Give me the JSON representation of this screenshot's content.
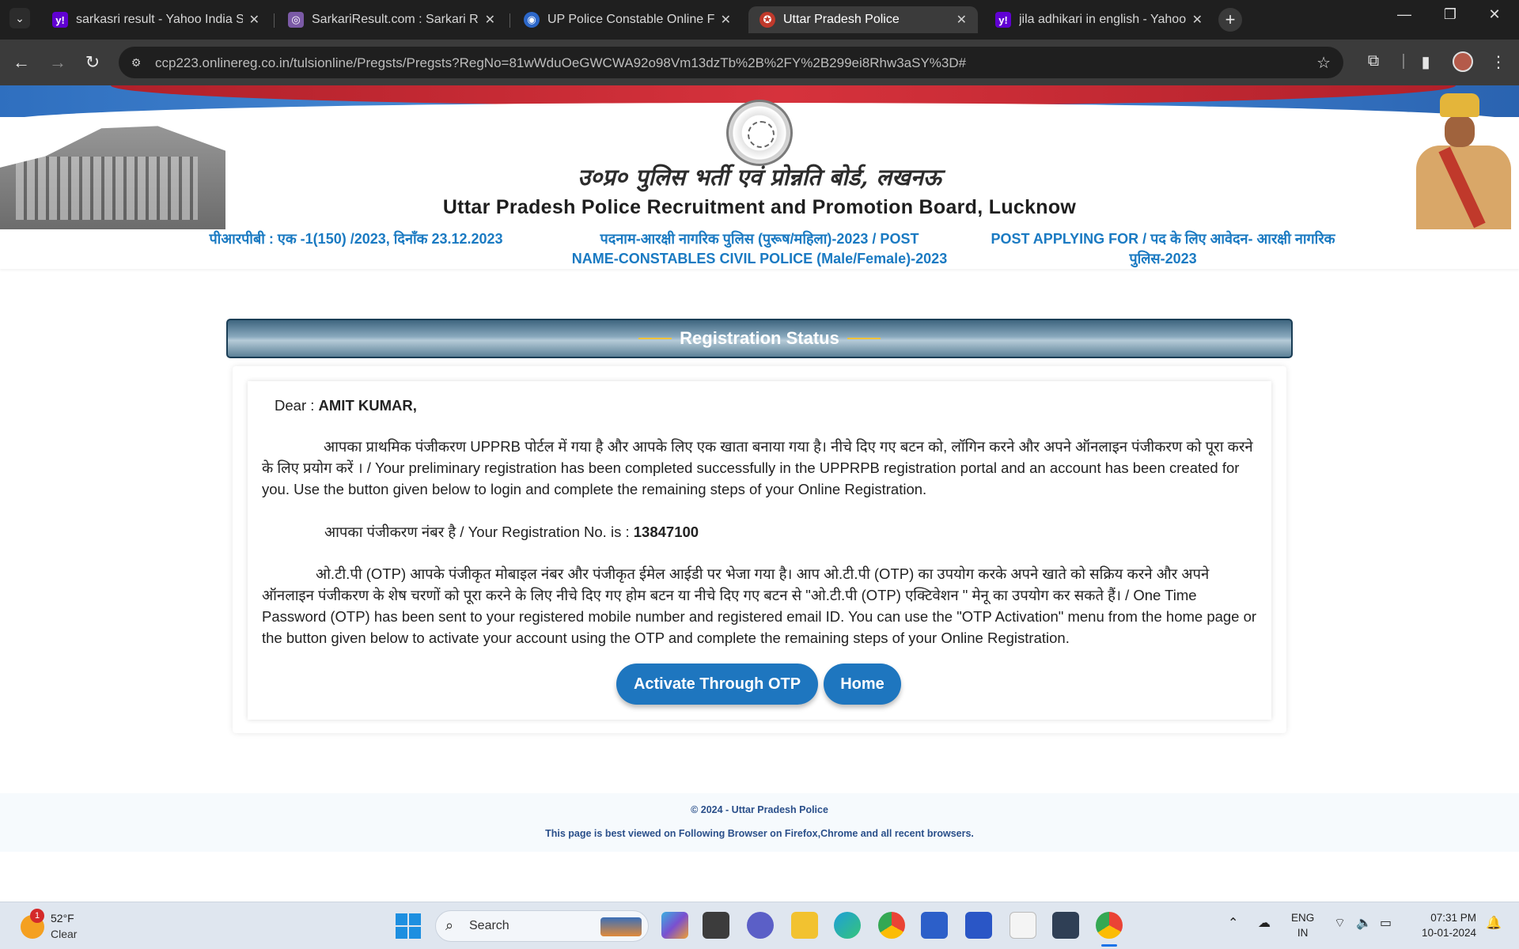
{
  "browser": {
    "tabs": [
      {
        "title": "sarkasri result - Yahoo India Sea",
        "favicon": "yahoo-icon",
        "color": "#6001d2",
        "active": false
      },
      {
        "title": "SarkariResult.com : Sarkari Resu",
        "favicon": "sarkari-icon",
        "color": "#7b5aa6",
        "active": false
      },
      {
        "title": "UP Police Constable Online For",
        "favicon": "globe-icon",
        "color": "#2c67c9",
        "active": false
      },
      {
        "title": "Uttar Pradesh Police",
        "favicon": "police-icon",
        "color": "#c0392b",
        "active": true
      },
      {
        "title": "jila adhikari in english - Yahoo I",
        "favicon": "yahoo-icon",
        "color": "#6001d2",
        "active": false
      }
    ],
    "url": "ccp223.onlinereg.co.in/tulsionline/Pregsts/Pregsts?RegNo=81wWduOeGWCWA92o98Vm13dzTb%2B%2FY%2B299ei8Rhw3aSY%3D#"
  },
  "header": {
    "hindi_title": "उ०प्र० पुलिस भर्ती एवं प्रोन्नति बोर्ड, लखनऊ",
    "english_title": "Uttar Pradesh Police Recruitment and Promotion Board, Lucknow",
    "info_left": "पीआरपीबी : एक -1(150) /2023, दिनाँक 23.12.2023",
    "info_center_line1": "पदनाम-आरक्षी नागरिक पुलिस (पुरूष/महिला)-2023 / POST",
    "info_center_line2": "NAME-CONSTABLES CIVIL POLICE (Male/Female)-2023",
    "info_right_line1": "POST APPLYING FOR / पद के लिए आवेदन- आरक्षी नागरिक",
    "info_right_line2": "पुलिस-2023"
  },
  "panel": {
    "title": "Registration Status",
    "dear_label": "Dear : ",
    "name": "AMIT KUMAR,",
    "para1": "आपका प्राथमिक पंजीकरण UPPRB पोर्टल में गया है और आपके लिए एक खाता बनाया गया है। नीचे दिए गए बटन को, लॉगिन करने और अपने ऑनलाइन पंजीकरण को पूरा करने के लिए प्रयोग करें । / Your preliminary registration has been completed successfully in the UPPRPB registration portal and an account has been created for you. Use the button given below to login and complete the remaining steps of your Online Registration.",
    "reg_label": "आपका पंजीकरण नंबर है / Your Registration No. is : ",
    "reg_no": "13847100",
    "para3": "ओ.टी.पी (OTP) आपके पंजीकृत मोबाइल नंबर और पंजीकृत ईमेल आईडी पर भेजा गया है। आप ओ.टी.पी (OTP) का उपयोग करके अपने खाते को सक्रिय करने और अपने ऑनलाइन पंजीकरण के शेष चरणों को पूरा करने के लिए नीचे दिए गए होम बटन या नीचे दिए गए बटन से \"ओ.टी.पी (OTP) एक्टिवेशन \" मेनू का उपयोग कर सकते हैं। / One Time Password (OTP) has been sent to your registered mobile number and registered email ID. You can use the \"OTP Activation\" menu from the home page or the button given below to activate your account using the OTP and complete the remaining steps of your Online Registration.",
    "btn_otp": "Activate Through OTP",
    "btn_home": "Home"
  },
  "footer": {
    "copyright": "© 2024 - Uttar Pradesh Police",
    "browser_note": "This page is best viewed on Following Browser on Firefox,Chrome and all recent browsers."
  },
  "taskbar": {
    "weather_temp": "52°F",
    "weather_cond": "Clear",
    "weather_badge": "1",
    "search_label": "Search",
    "lang_line1": "ENG",
    "lang_line2": "IN",
    "time": "07:31 PM",
    "date": "10-01-2024"
  }
}
